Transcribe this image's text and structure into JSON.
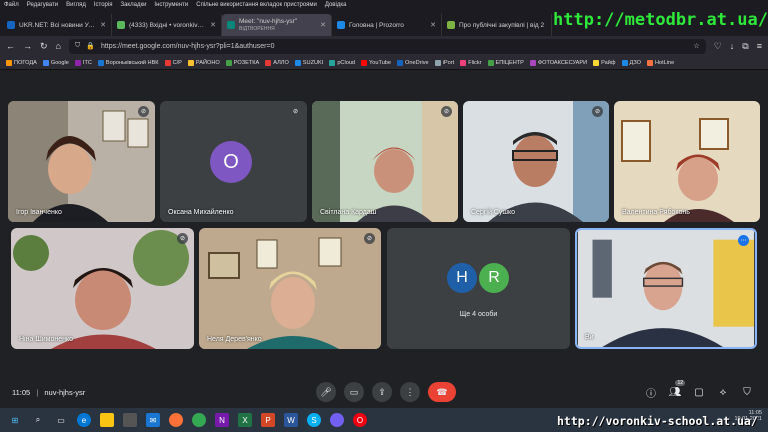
{
  "menubar": [
    "Файл",
    "Редагувати",
    "Вигляд",
    "Історія",
    "Закладки",
    "Інструменти",
    "Спільне використання вкладок пристроями",
    "Довідка"
  ],
  "tabs": [
    {
      "label": "UKR.NET: Всі новини України",
      "color": "#1565c0"
    },
    {
      "label": "(4333) Вхідні • voronkiv-school",
      "color": "#5cb85c"
    },
    {
      "label": "Meet: \"nuv-hjhs-ysr\"",
      "sub": "ВІДТВОРЕННЯ",
      "color": "#00897b",
      "active": true
    },
    {
      "label": "Головна | Prozorro",
      "color": "#1e88e5"
    },
    {
      "label": "Про публічні закупівлі | від 2",
      "color": "#7cb342"
    }
  ],
  "navbar": {
    "url": "https://meet.google.com/nuv-hjhs-ysr?pli=1&authuser=0"
  },
  "bookmarks": [
    {
      "label": "ПОГОДА",
      "color": "#ff9800"
    },
    {
      "label": "Google",
      "color": "#4285f4"
    },
    {
      "label": "ITC",
      "color": "#8e24aa"
    },
    {
      "label": "Вороньківський НВК",
      "color": "#1976d2"
    },
    {
      "label": "C/P",
      "color": "#e53935"
    },
    {
      "label": "РАЙОНО",
      "color": "#fbc02d"
    },
    {
      "label": "РОЗЕТКА",
      "color": "#43a047"
    },
    {
      "label": "АЛЛО",
      "color": "#e53935"
    },
    {
      "label": "SUZUKI",
      "color": "#1e88e5"
    },
    {
      "label": "pCloud",
      "color": "#26a69a"
    },
    {
      "label": "YouTube",
      "color": "#ff0000"
    },
    {
      "label": "OneDrive",
      "color": "#1565c0"
    },
    {
      "label": "iPort",
      "color": "#90a4ae"
    },
    {
      "label": "Flickr",
      "color": "#ec407a"
    },
    {
      "label": "ЕПІЦЕНТР",
      "color": "#43a047"
    },
    {
      "label": "ФОТОАКСЕСУАРИ",
      "color": "#ab47bc"
    },
    {
      "label": "Райф",
      "color": "#fdd835"
    },
    {
      "label": "ДЗО",
      "color": "#1e88e5"
    },
    {
      "label": "HotLine",
      "color": "#ff7043"
    }
  ],
  "participants": [
    {
      "name": "Ігор Іванченко"
    },
    {
      "name": "Оксана Михайленко",
      "initial": "O"
    },
    {
      "name": "Світлана Кардаш"
    },
    {
      "name": "Сергій Сушко"
    },
    {
      "name": "Валентина Рябоконь"
    },
    {
      "name": "Ніна Шимоненко"
    },
    {
      "name": "Неля Дерев'янко"
    },
    {
      "name": "Ще 4 особи",
      "initials": [
        "H",
        "R"
      ]
    },
    {
      "name": "Ви"
    }
  ],
  "meeting": {
    "time": "11:05",
    "separator": "|",
    "code": "nuv-hjhs-ysr",
    "people_count": "12"
  },
  "watermarks": {
    "top": "http://metodbr.at.ua/",
    "bottom": "http://voronkiv-school.at.ua/"
  },
  "tray": {
    "time": "11:05",
    "date": "19.01.2021"
  }
}
